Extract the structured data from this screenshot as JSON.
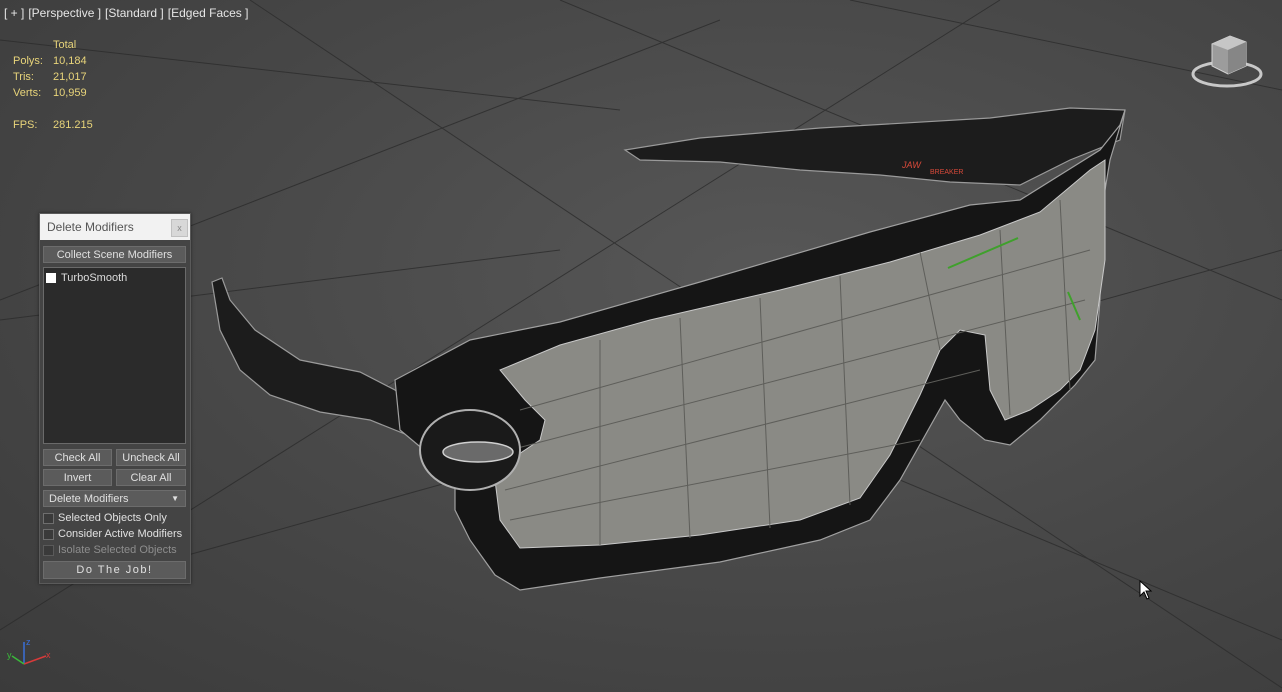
{
  "viewport": {
    "labels": [
      "[ + ]",
      "[Perspective ]",
      "[Standard ]",
      "[Edged Faces ]"
    ],
    "stats": {
      "header": "Total",
      "rows": [
        {
          "key": "Polys:",
          "value": "10,184"
        },
        {
          "key": "Tris:",
          "value": "21,017"
        },
        {
          "key": "Verts:",
          "value": "10,959"
        }
      ],
      "fps_key": "FPS:",
      "fps_value": "281.215"
    },
    "background_color": "#4a4a4a",
    "stats_color": "#e8d47a"
  },
  "dialog": {
    "title": "Delete Modifiers",
    "close_label": "x",
    "collect_button": "Collect Scene Modifiers",
    "list_items": [
      {
        "label": "TurboSmooth",
        "checked": false
      }
    ],
    "check_all": "Check All",
    "uncheck_all": "Uncheck All",
    "invert": "Invert",
    "clear_all": "Clear All",
    "mode_dropdown": "Delete Modifiers",
    "options": {
      "selected_only": "Selected Objects Only",
      "consider_active": "Consider Active Modifiers",
      "isolate_selected": "Isolate Selected Objects"
    },
    "do_job": "Do The Job!"
  },
  "axis_gizmo": {
    "x": "x",
    "y": "y",
    "z": "z"
  },
  "icons": {
    "viewcube": "viewcube-icon",
    "cursor": "mouse-cursor-icon",
    "axis": "axis-gizmo-icon",
    "dropdown": "chevron-down-icon"
  }
}
